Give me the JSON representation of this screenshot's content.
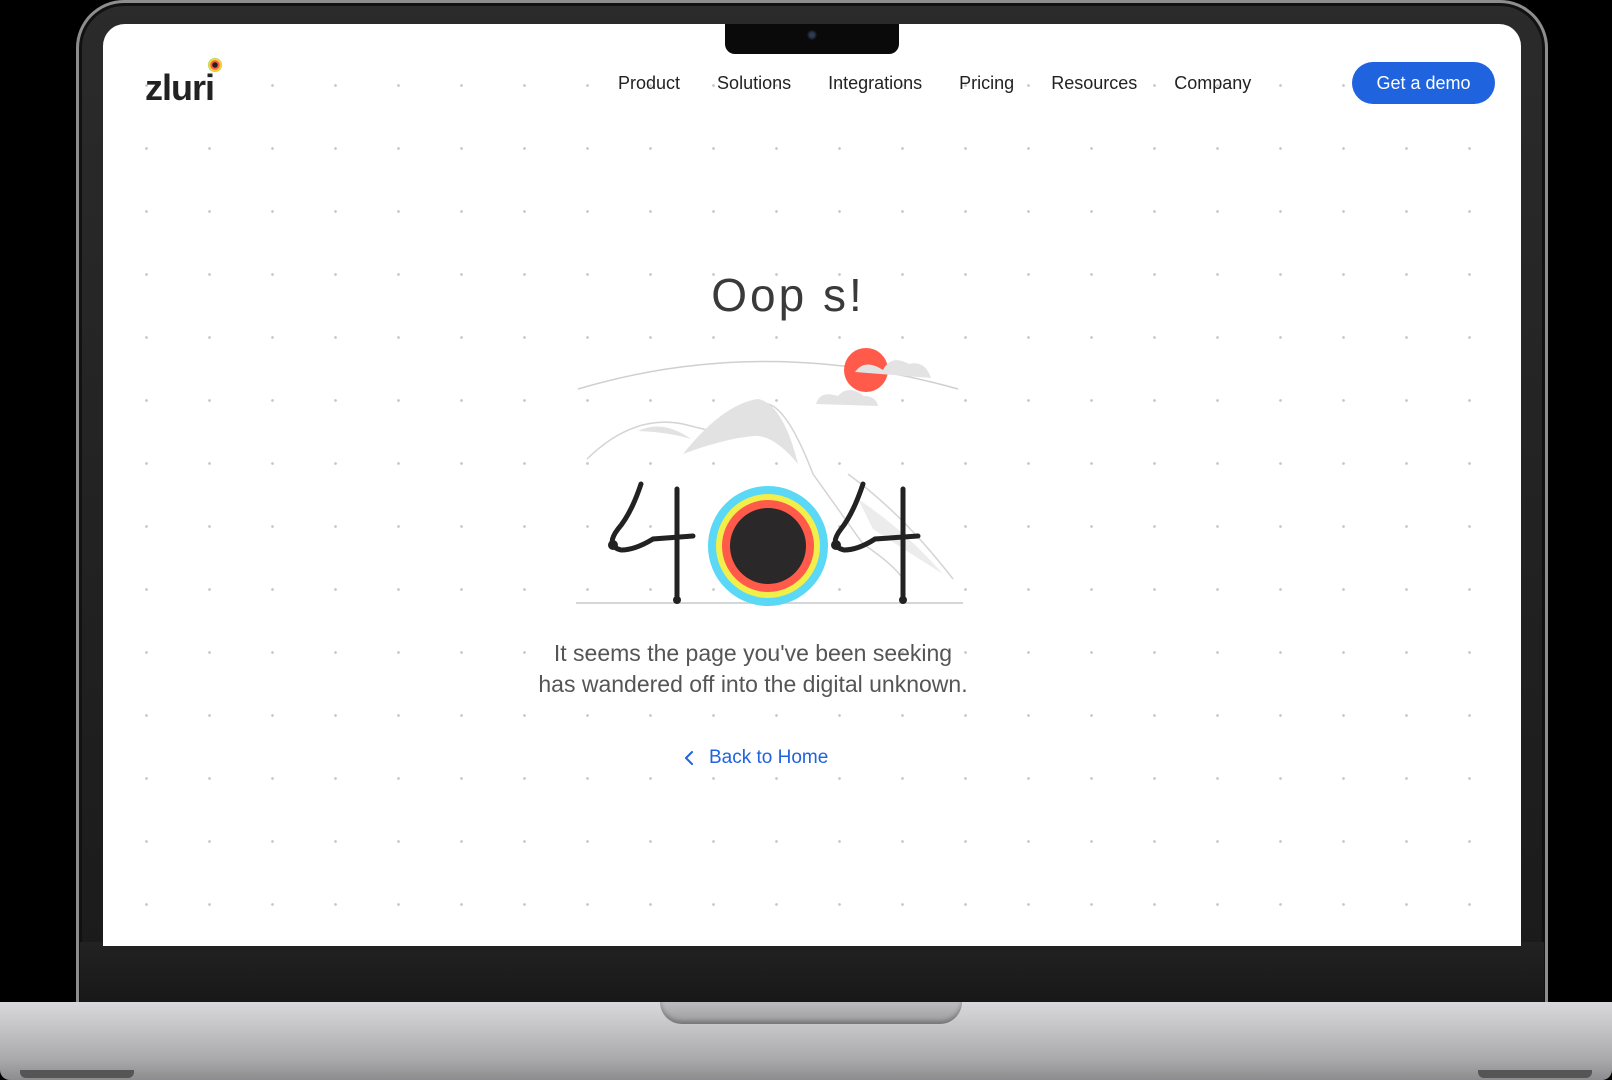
{
  "header": {
    "logo_text": "zluri",
    "nav": [
      "Product",
      "Solutions",
      "Integrations",
      "Pricing",
      "Resources",
      "Company"
    ],
    "cta_label": "Get a demo"
  },
  "main": {
    "heading": "Oop s!",
    "error_code": "404",
    "message_line1": "It seems the page you've been seeking",
    "message_line2": "has wandered off into the digital unknown.",
    "back_label": "Back to Home"
  },
  "colors": {
    "accent": "#1f63df",
    "sun": "#ff5a4a",
    "ring_outer": "#5ad8f5",
    "ring_mid": "#f3ef4a",
    "ring_inner": "#ff5a4a",
    "core": "#2a2828"
  },
  "icons": {
    "back": "chevron-left-icon",
    "logo_mark": "zluri-logo-icon"
  }
}
